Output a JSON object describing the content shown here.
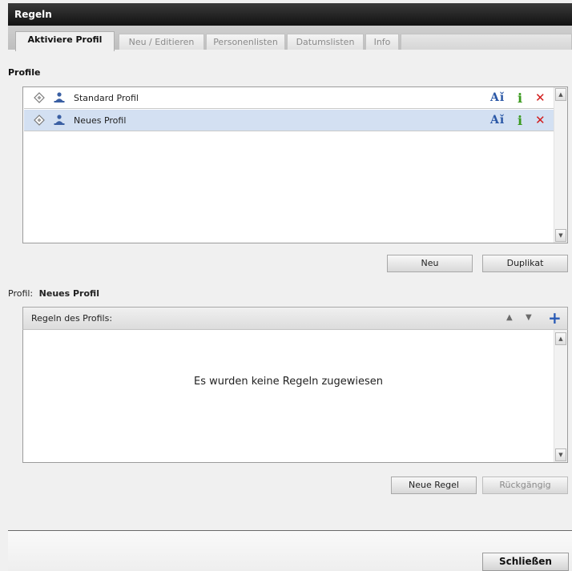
{
  "window": {
    "title": "Regeln"
  },
  "tabs": [
    {
      "label": "Aktiviere Profil",
      "active": true
    },
    {
      "label": "Neu / Editieren",
      "active": false
    },
    {
      "label": "Personenlisten",
      "active": false
    },
    {
      "label": "Datumslisten",
      "active": false
    },
    {
      "label": "Info",
      "active": false
    }
  ],
  "profiles": {
    "heading": "Profile",
    "items": [
      {
        "name": "Standard Profil",
        "selected": false,
        "icons": [
          "diamond-icon",
          "person-icon",
          "rename-icon",
          "info-icon",
          "delete-icon"
        ]
      },
      {
        "name": "Neues Profil",
        "selected": true,
        "icons": [
          "diamond-icon",
          "person-icon",
          "rename-icon",
          "info-icon",
          "delete-icon"
        ]
      }
    ],
    "action_icons": {
      "rename": "Aǐ",
      "info": "i",
      "delete": "✕"
    },
    "buttons": {
      "new": "Neu",
      "duplicate": "Duplikat"
    }
  },
  "profile_detail": {
    "label": "Profil:",
    "name": "Neues Profil",
    "rules_header": "Regeln des Profils:",
    "empty_message": "Es wurden keine Regeln zugewiesen",
    "controls": {
      "up": "▲",
      "down": "▼",
      "add": "+"
    },
    "buttons": {
      "new_rule": "Neue Regel",
      "undo": "Rückgängig"
    }
  },
  "footer": {
    "close": "Schließen"
  },
  "colors": {
    "selection": "#d3e0f2",
    "rename": "#2a57a6",
    "info": "#3a9a1e",
    "delete": "#d21c1c",
    "add": "#2a5bb6"
  }
}
